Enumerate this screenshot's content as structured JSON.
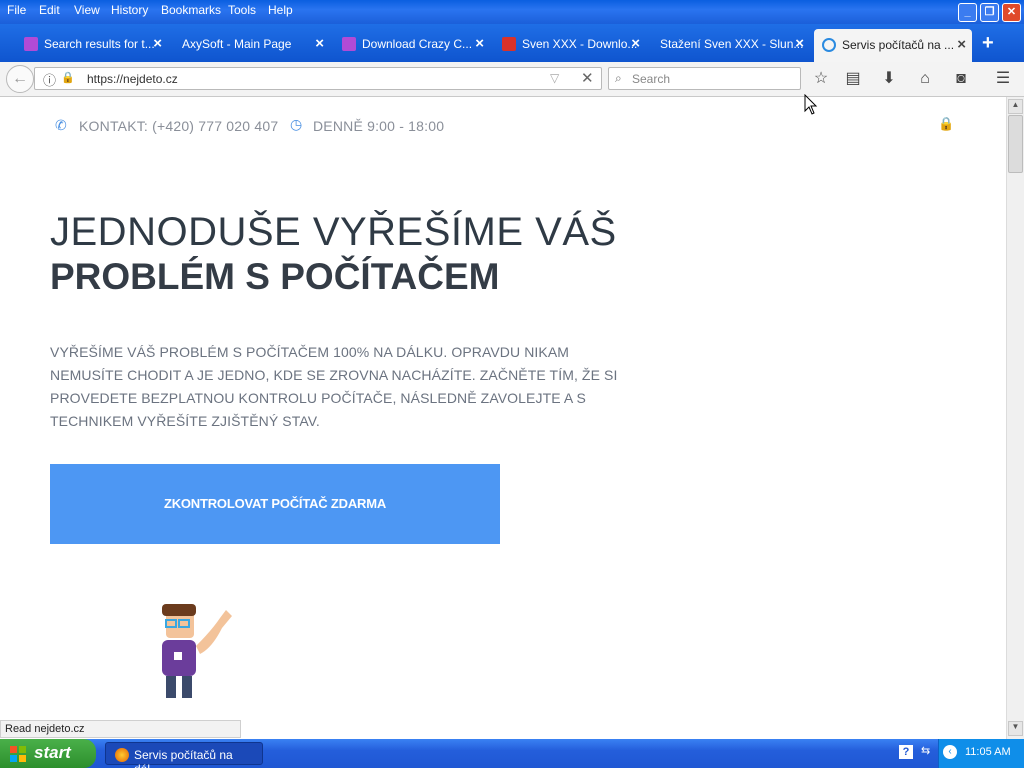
{
  "menu": [
    "File",
    "Edit",
    "View",
    "History",
    "Bookmarks",
    "Tools",
    "Help"
  ],
  "tabs": [
    {
      "label": "Search results for t...",
      "active": false,
      "favicon_color": "#b24bd6"
    },
    {
      "label": "AxySoft - Main Page",
      "active": false,
      "favicon_color": ""
    },
    {
      "label": "Download Crazy C...",
      "active": false,
      "favicon_color": "#b24bd6"
    },
    {
      "label": "Sven XXX - Downlo...",
      "active": false,
      "favicon_color": "#d8322a"
    },
    {
      "label": "Stažení Sven XXX - Slun...",
      "active": false,
      "favicon_color": ""
    },
    {
      "label": "Servis počítačů na ...",
      "active": true,
      "favicon_color": "#2a8ae0"
    }
  ],
  "address": {
    "url": "https://nejdeto.cz"
  },
  "search": {
    "placeholder": "Search"
  },
  "page": {
    "contact": "KONTAKT: (+420) 777 020 407",
    "hours": "DENNĚ 9:00 - 18:00",
    "heading_line1": "JEDNODUŠE VYŘEŠÍME VÁŠ",
    "heading_line2": "PROBLÉM S POČÍTAČEM",
    "paragraph": "VYŘEŠÍME VÁŠ PROBLÉM S POČÍTAČEM 100% NA DÁLKU. OPRAVDU NIKAM NEMUSÍTE CHODIT A JE JEDNO, KDE SE ZROVNA NACHÁZÍTE. ZAČNĚTE TÍM, ŽE SI PROVEDETE BEZPLATNOU KONTROLU POČÍTAČE, NÁSLEDNĚ ZAVOLEJTE A S TECHNIKEM VYŘEŠÍTE ZJIŠTĚNÝ STAV.",
    "cta": "ZKONTROLOVAT POČÍTAČ ZDARMA"
  },
  "status_text": "Read nejdeto.cz",
  "taskbar": {
    "start_label": "start",
    "item_label": "Servis počítačů na dál...",
    "clock": "11:05 AM"
  },
  "colors": {
    "accent": "#4d97f3",
    "xp_blue": "#245edb"
  }
}
